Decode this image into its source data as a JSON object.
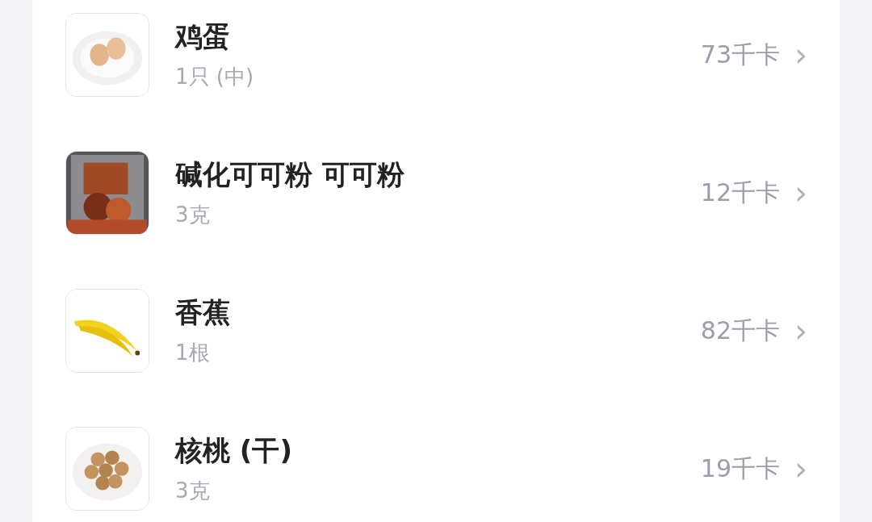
{
  "foods": [
    {
      "name": "鸡蛋",
      "portion": "1只 (中)",
      "calories": "73千卡",
      "chevron": "›"
    },
    {
      "name": "碱化可可粉 可可粉",
      "portion": "3克",
      "calories": "12千卡",
      "chevron": "›"
    },
    {
      "name": "香蕉",
      "portion": "1根",
      "calories": "82千卡",
      "chevron": "›"
    },
    {
      "name": "核桃 (干)",
      "portion": "3克",
      "calories": "19千卡",
      "chevron": "›"
    }
  ]
}
